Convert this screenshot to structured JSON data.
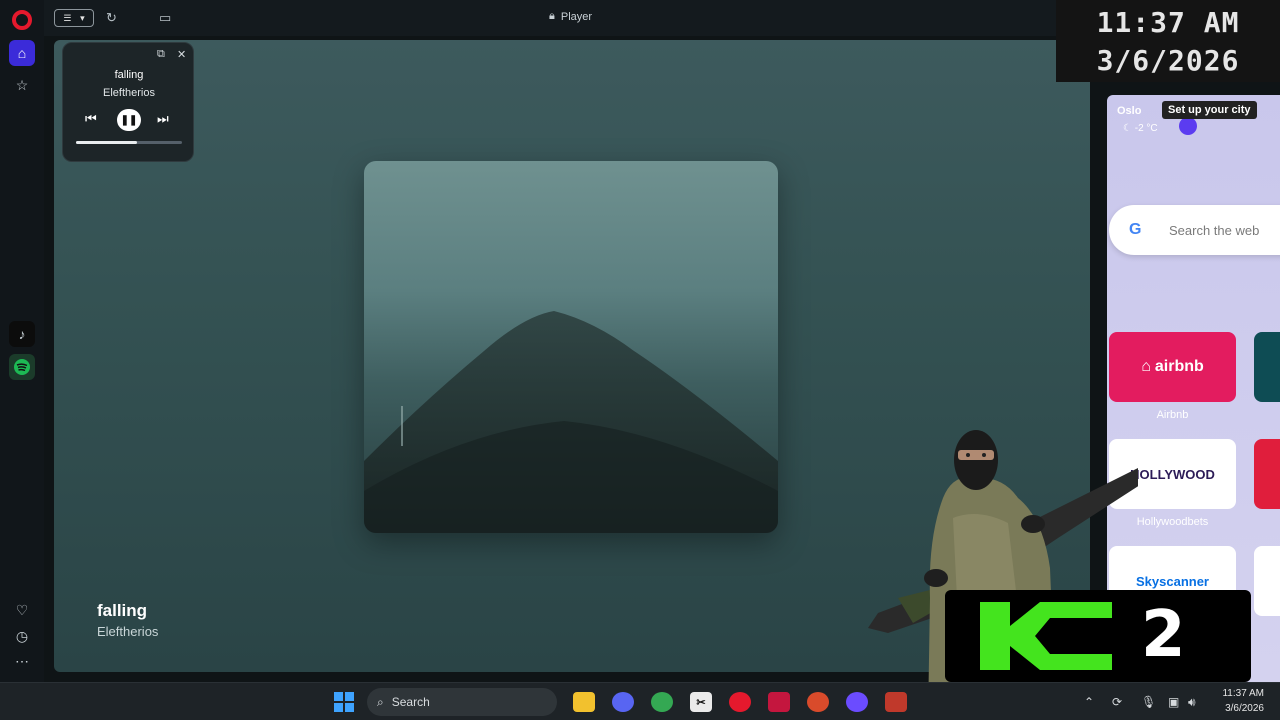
{
  "browser": {
    "address_text": "Player"
  },
  "mini_player": {
    "title": "falling",
    "artist": "Eleftherios",
    "progress": 0.58
  },
  "now_playing": {
    "title": "falling",
    "artist": "Eleftherios"
  },
  "weather": {
    "city": "Oslo",
    "temperature": "-2 °C",
    "tooltip": "Set up your city"
  },
  "search": {
    "placeholder": "Search the web"
  },
  "speed_dial": [
    {
      "label": "Airbnb",
      "tile_text": "airbnb",
      "color": "#e31c5f"
    },
    {
      "label": "Hollywoodbets",
      "tile_text": "HOLLYWOOD",
      "color": "#ffffff"
    },
    {
      "label": "",
      "tile_text": "Skyscanner",
      "color": "#ffffff"
    }
  ],
  "overlay_clock": {
    "time": "11:37 AM",
    "date": "3/6/2026"
  },
  "overlay_logo": {
    "number": "2",
    "accent": "#44e41e"
  },
  "taskbar": {
    "search_label": "Search",
    "time": "11:37 AM",
    "date": "3/6/2026"
  },
  "colors": {
    "opera_red": "#e5192d",
    "accent_blue": "#3b2bd9",
    "spotify_green": "#1db954"
  }
}
